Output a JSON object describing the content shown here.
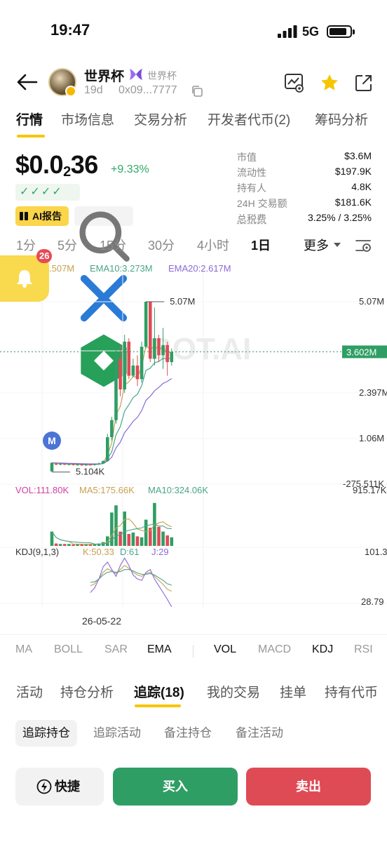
{
  "status_bar": {
    "time": "19:47",
    "network": "5G"
  },
  "token": {
    "name": "世界杯",
    "sub_name": "世界杯",
    "age": "19d",
    "address": "0x09...7777"
  },
  "main_tabs": [
    "行情",
    "市场信息",
    "交易分析",
    "开发者代币(2)",
    "筹码分析"
  ],
  "price": {
    "prefix": "$0.0",
    "sub_zeros": "2",
    "digits": "36",
    "change": "+9.33%"
  },
  "checks": "✓✓✓✓",
  "ai_report_label": "AI报告",
  "stats": [
    {
      "label": "市值",
      "value": "$3.6M"
    },
    {
      "label": "流动性",
      "value": "$197.9K"
    },
    {
      "label": "持有人",
      "value": "4.8K"
    },
    {
      "label": "24H 交易额",
      "value": "$181.6K"
    },
    {
      "label": "总税费",
      "value": "3.25% / 3.25%"
    }
  ],
  "timeframes": [
    "1分",
    "5分",
    "15分",
    "30分",
    "4小时",
    "1日"
  ],
  "active_timeframe": "1日",
  "more_label": "更多",
  "alert": {
    "count": "26"
  },
  "marker_label": "M",
  "chart_data": {
    "type": "candlestick",
    "ema_legend": {
      "partial": ".507M",
      "ema10": "EMA10:3.273M",
      "ema20": "EMA20:2.617M"
    },
    "y_ticks": [
      "5.07M",
      "3.602M",
      "2.397M",
      "1.06M",
      "-275.511K"
    ],
    "current_price_tag": "3.602M",
    "max_label": "5.07M",
    "min_label": "5.104K",
    "watermark": "BOT.AI",
    "x_tick": "26-05-22",
    "candles": [
      [
        0.1,
        0.35,
        0.08,
        0.36
      ],
      [
        0.32,
        0.3,
        0.28,
        0.36
      ],
      [
        0.3,
        0.32,
        0.28,
        0.34
      ],
      [
        0.32,
        0.3,
        0.28,
        0.34
      ],
      [
        0.3,
        0.31,
        0.28,
        0.33
      ],
      [
        0.31,
        0.29,
        0.27,
        0.33
      ],
      [
        0.29,
        0.3,
        0.27,
        0.32
      ],
      [
        0.3,
        0.28,
        0.26,
        0.32
      ],
      [
        0.28,
        0.3,
        0.26,
        0.31
      ],
      [
        0.3,
        0.29,
        0.27,
        0.32
      ],
      [
        0.29,
        0.31,
        0.27,
        0.33
      ],
      [
        0.31,
        0.33,
        0.29,
        0.36
      ],
      [
        0.33,
        0.4,
        0.32,
        0.42
      ],
      [
        0.4,
        1.1,
        0.38,
        1.2
      ],
      [
        1.1,
        1.6,
        1.0,
        1.7
      ],
      [
        1.6,
        3.4,
        1.5,
        3.7
      ],
      [
        3.4,
        2.5,
        2.3,
        3.8
      ],
      [
        2.5,
        3.9,
        2.4,
        4.1
      ],
      [
        3.9,
        2.9,
        2.8,
        4.0
      ],
      [
        2.9,
        3.2,
        2.85,
        3.4
      ],
      [
        3.2,
        2.8,
        2.6,
        3.5
      ],
      [
        2.8,
        3.75,
        2.7,
        3.9
      ],
      [
        3.75,
        5.07,
        3.7,
        5.07
      ],
      [
        5.07,
        3.4,
        3.3,
        4.8
      ],
      [
        3.4,
        4.0,
        3.2,
        4.9
      ],
      [
        4.0,
        3.5,
        3.3,
        4.1
      ],
      [
        3.5,
        3.8,
        3.1,
        4.3
      ],
      [
        3.8,
        3.3,
        2.9,
        3.9
      ],
      [
        3.3,
        3.6,
        3.2,
        3.7
      ]
    ],
    "vol_legend": {
      "vol": "VOL:111.80K",
      "ma5": "MA5:175.66K",
      "ma10": "MA10:324.06K"
    },
    "vol_max_tick": "915.17K",
    "volumes": [
      0.3,
      0.05,
      0.04,
      0.04,
      0.04,
      0.03,
      0.04,
      0.03,
      0.03,
      0.04,
      0.04,
      0.05,
      0.08,
      0.2,
      0.7,
      0.85,
      0.3,
      0.72,
      0.25,
      0.28,
      0.2,
      0.18,
      0.55,
      0.38,
      0.9,
      0.4,
      0.3,
      0.22,
      0.18,
      0.15,
      0.12
    ],
    "kdj_legend": {
      "kdj": "KDJ(9,1,3)",
      "k": "K:50.33",
      "d": "D:61",
      "j": "J:29"
    },
    "kdj_ticks": [
      "101.3",
      "28.79"
    ]
  },
  "indicators": [
    "MA",
    "BOLL",
    "SAR",
    "EMA",
    "VOL",
    "MACD",
    "KDJ",
    "RSI"
  ],
  "section_tabs": [
    "活动",
    "持仓分析",
    "追踪(18)",
    "我的交易",
    "挂单",
    "持有代币"
  ],
  "sub_tabs": [
    "追踪持仓",
    "追踪活动",
    "备注持仓",
    "备注活动"
  ],
  "actions": {
    "quick": "快捷",
    "buy": "买入",
    "sell": "卖出"
  }
}
